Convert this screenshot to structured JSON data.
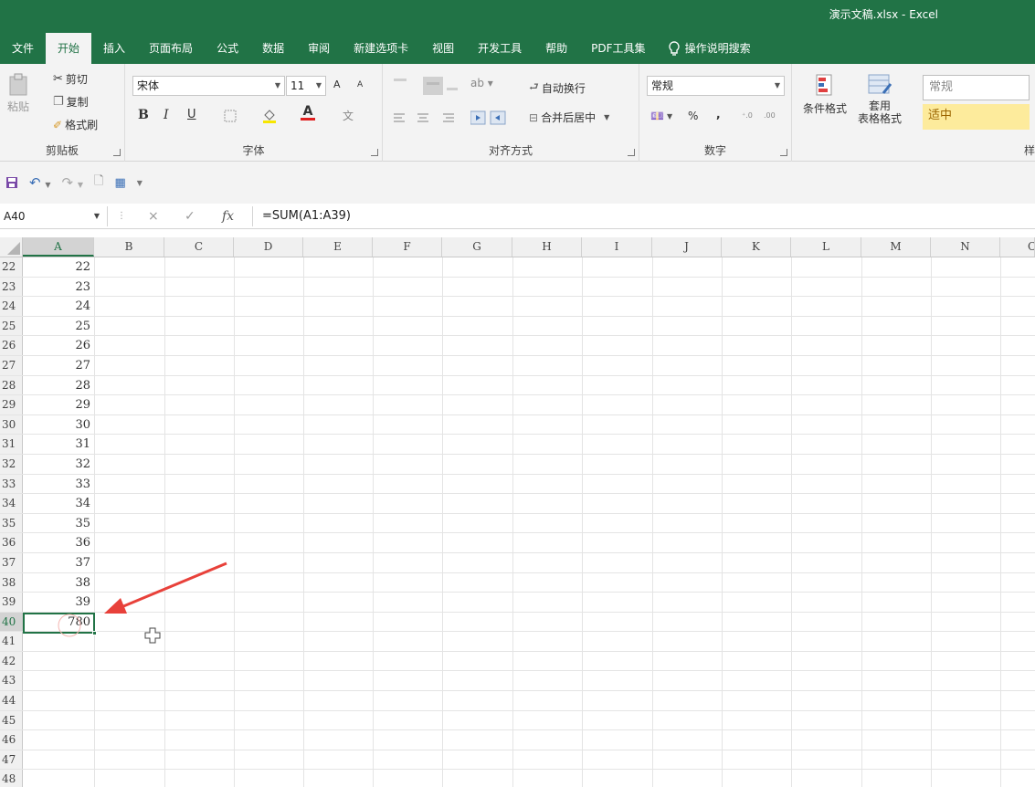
{
  "app": {
    "doc_title": "演示文稿.xlsx  -  Excel"
  },
  "tabs": [
    {
      "label": "文件"
    },
    {
      "label": "开始"
    },
    {
      "label": "插入"
    },
    {
      "label": "页面布局"
    },
    {
      "label": "公式"
    },
    {
      "label": "数据"
    },
    {
      "label": "审阅"
    },
    {
      "label": "新建选项卡"
    },
    {
      "label": "视图"
    },
    {
      "label": "开发工具"
    },
    {
      "label": "帮助"
    },
    {
      "label": "PDF工具集"
    }
  ],
  "tell_me": "操作说明搜索",
  "ribbon": {
    "clipboard": {
      "paste": "粘贴",
      "cut": "剪切",
      "copy": "复制",
      "format_painter": "格式刷",
      "label": "剪贴板"
    },
    "font": {
      "name": "宋体",
      "size": "11",
      "bold": "B",
      "italic": "I",
      "underline": "U",
      "grow": "A",
      "shrink": "A",
      "color_letter": "A",
      "phonetic": "文",
      "label": "字体"
    },
    "alignment": {
      "wrap": "自动换行",
      "merge": "合并后居中",
      "label": "对齐方式"
    },
    "number": {
      "format": "常规",
      "percent": "%",
      "comma": ",",
      "label": "数字"
    },
    "styles": {
      "conditional": "条件格式",
      "table_format_1": "套用",
      "table_format_2": "表格格式",
      "style_normal": "常规",
      "style_neutral": "适中",
      "label": "样"
    }
  },
  "formula_bar": {
    "name_box": "A40",
    "formula": "=SUM(A1:A39)",
    "cancel": "×",
    "enter": "✓",
    "fx": "fx"
  },
  "columns": [
    "A",
    "B",
    "C",
    "D",
    "E",
    "F",
    "G",
    "H",
    "I",
    "J",
    "K",
    "L",
    "M",
    "N",
    "O"
  ],
  "rows": [
    {
      "num": "22",
      "a": "22"
    },
    {
      "num": "23",
      "a": "23"
    },
    {
      "num": "24",
      "a": "24"
    },
    {
      "num": "25",
      "a": "25"
    },
    {
      "num": "26",
      "a": "26"
    },
    {
      "num": "27",
      "a": "27"
    },
    {
      "num": "28",
      "a": "28"
    },
    {
      "num": "29",
      "a": "29"
    },
    {
      "num": "30",
      "a": "30"
    },
    {
      "num": "31",
      "a": "31"
    },
    {
      "num": "32",
      "a": "32"
    },
    {
      "num": "33",
      "a": "33"
    },
    {
      "num": "34",
      "a": "34"
    },
    {
      "num": "35",
      "a": "35"
    },
    {
      "num": "36",
      "a": "36"
    },
    {
      "num": "37",
      "a": "37"
    },
    {
      "num": "38",
      "a": "38"
    },
    {
      "num": "39",
      "a": "39"
    },
    {
      "num": "40",
      "a": "780"
    },
    {
      "num": "41",
      "a": ""
    },
    {
      "num": "42",
      "a": ""
    },
    {
      "num": "43",
      "a": ""
    },
    {
      "num": "44",
      "a": ""
    },
    {
      "num": "45",
      "a": ""
    },
    {
      "num": "46",
      "a": ""
    },
    {
      "num": "47",
      "a": ""
    },
    {
      "num": "48",
      "a": ""
    }
  ],
  "colors": {
    "excel_green": "#217346",
    "annotation_red": "#e8413a"
  }
}
